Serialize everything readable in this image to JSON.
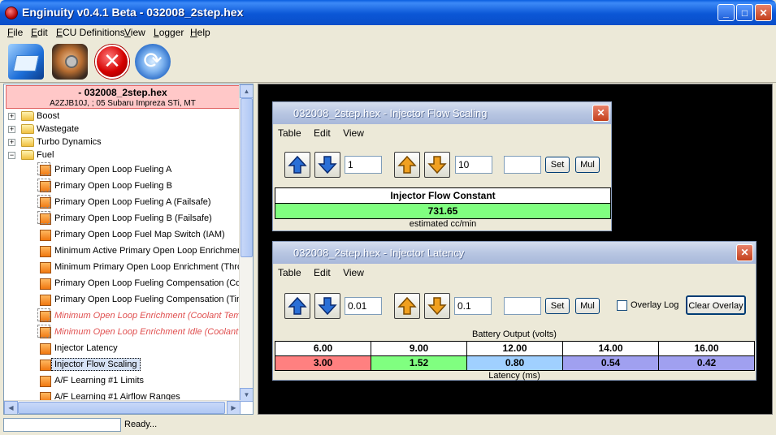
{
  "window": {
    "title": "Enginuity v0.4.1 Beta - 032008_2step.hex"
  },
  "menu": [
    "File",
    "Edit",
    "ECU Definitions",
    "View",
    "Logger",
    "Help"
  ],
  "toolbar": {
    "close_glyph": "✕",
    "refresh_glyph": "⟳"
  },
  "rom": {
    "title": "- 032008_2step.hex",
    "subtitle": "A2ZJB10J, ; 05 Subaru Impreza STi, MT"
  },
  "tree": {
    "categories": [
      "Boost",
      "Wastegate",
      "Turbo Dynamics",
      "Fuel"
    ],
    "fuel_items": [
      "Primary Open Loop Fueling A",
      "Primary Open Loop Fueling B",
      "Primary Open Loop Fueling A (Failsafe)",
      "Primary Open Loop Fueling B (Failsafe)",
      "Primary Open Loop Fuel Map Switch (IAM)",
      "Minimum Active Primary Open Loop Enrichment",
      "Minimum Primary Open Loop Enrichment (Thrott",
      "Primary Open Loop Fueling Compensation (Cool",
      "Primary Open Loop Fueling Compensation (Timin",
      "Minimum Open Loop Enrichment (Coolant Temp)",
      "Minimum Open Loop Enrichment Idle (Coolant Te",
      "Injector Latency",
      "Injector Flow Scaling",
      "A/F Learning #1 Limits",
      "A/F Learning #1 Airflow Ranges"
    ]
  },
  "flow_window": {
    "title": "032008_2step.hex - Injector Flow Scaling",
    "menu": [
      "Table",
      "Edit",
      "View"
    ],
    "increment_value": "1",
    "coarse_value": "10",
    "set_value": "",
    "set_label": "Set",
    "mul_label": "Mul",
    "table_header": "Injector Flow Constant",
    "table_value": "731.65",
    "units": "estimated cc/min",
    "value_color": "#80ff80"
  },
  "latency_window": {
    "title": "032008_2step.hex - Injector Latency",
    "menu": [
      "Table",
      "Edit",
      "View"
    ],
    "increment_value": "0.01",
    "coarse_value": "0.1",
    "set_value": "",
    "set_label": "Set",
    "mul_label": "Mul",
    "overlay_label": "Overlay Log",
    "clear_overlay_label": "Clear Overlay",
    "x_axis_label": "Battery Output (volts)",
    "y_axis_label": "Latency (ms)",
    "x_values": [
      "6.00",
      "9.00",
      "12.00",
      "14.00",
      "16.00"
    ],
    "values": [
      "3.00",
      "1.52",
      "0.80",
      "0.54",
      "0.42"
    ],
    "value_colors": [
      "#ff8080",
      "#80ff80",
      "#a0d0ff",
      "#a0a0f0",
      "#a0a0f0"
    ]
  },
  "status": {
    "text": "Ready..."
  }
}
